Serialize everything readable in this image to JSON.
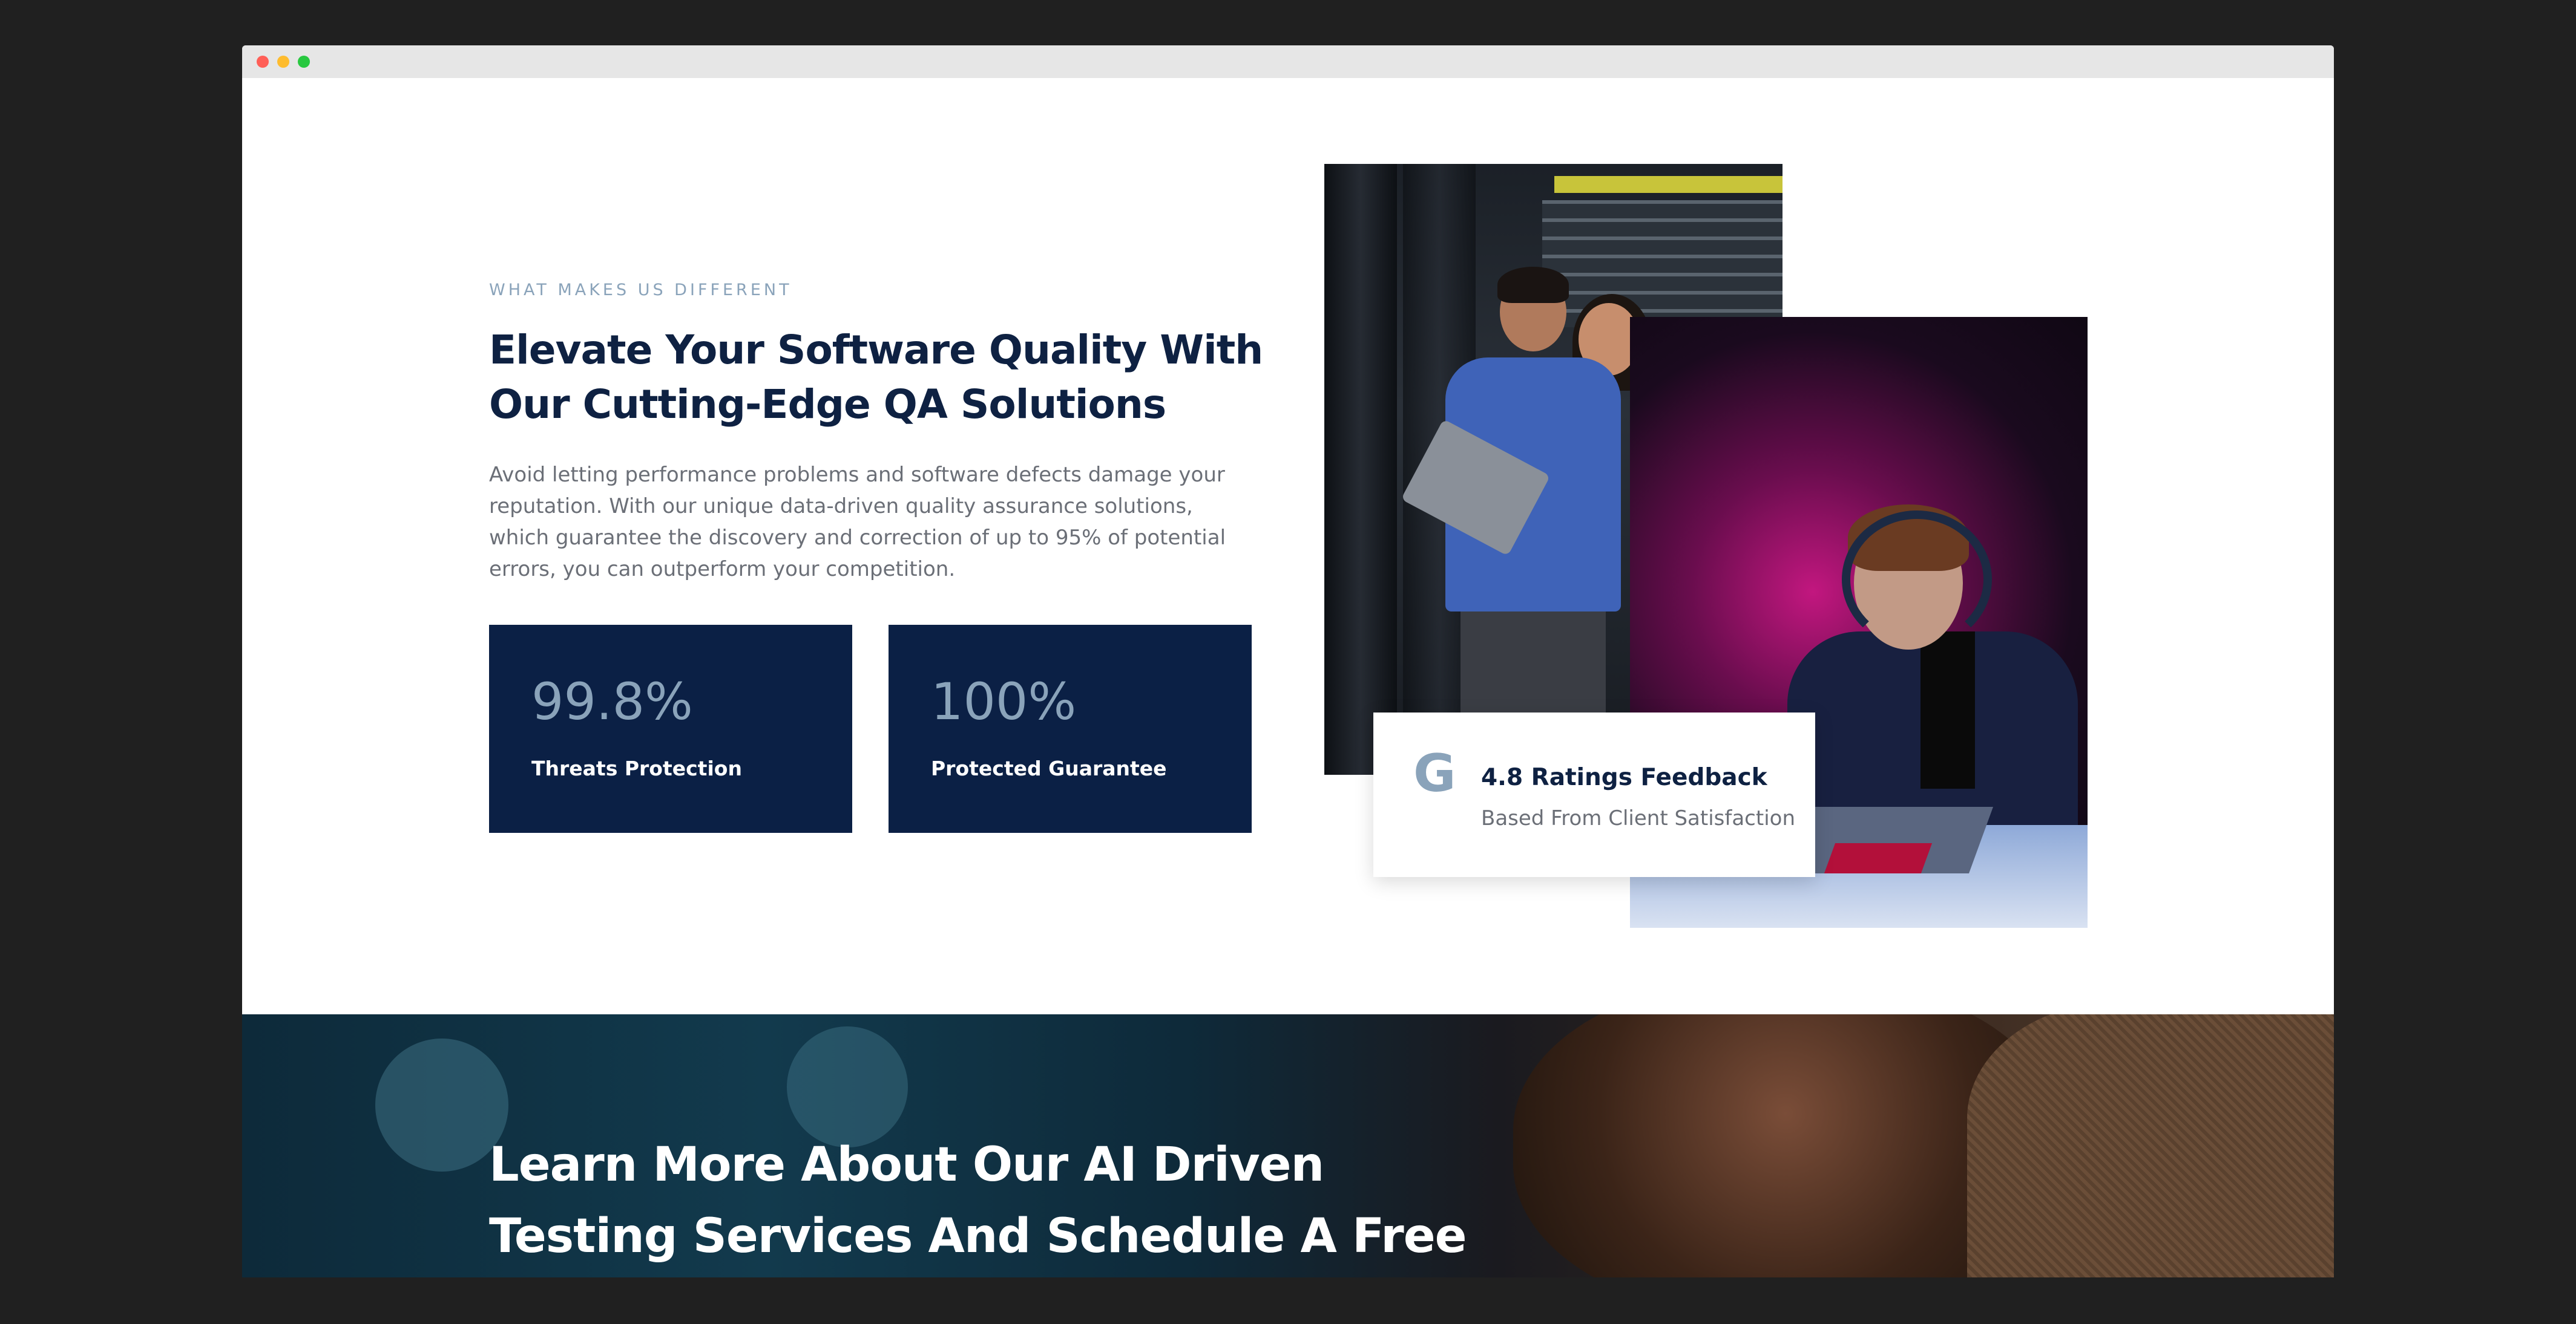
{
  "section": {
    "eyebrow": "WHAT MAKES US DIFFERENT",
    "headline": "Elevate Your Software Quality With Our Cutting-Edge QA Solutions",
    "body": "Avoid letting performance problems and software defects damage your reputation. With our unique data-driven quality assurance solutions, which guarantee the discovery and correction of up to 95% of potential errors, you can outperform your competition."
  },
  "stats": [
    {
      "value": "99.8%",
      "label": "Threats Protection"
    },
    {
      "value": "100%",
      "label": "Protected Guarantee"
    }
  ],
  "rating": {
    "icon": "google-icon",
    "icon_glyph": "G",
    "title": "4.8 Ratings Feedback",
    "subtitle": "Based From Client Satisfaction"
  },
  "cta": {
    "text": "Learn More About Our AI Driven Testing Services And Schedule A Free"
  },
  "colors": {
    "navy": "#0b2045",
    "accent": "#8aa3ba",
    "heading": "#0e2142",
    "body_text": "#6b6f77"
  }
}
